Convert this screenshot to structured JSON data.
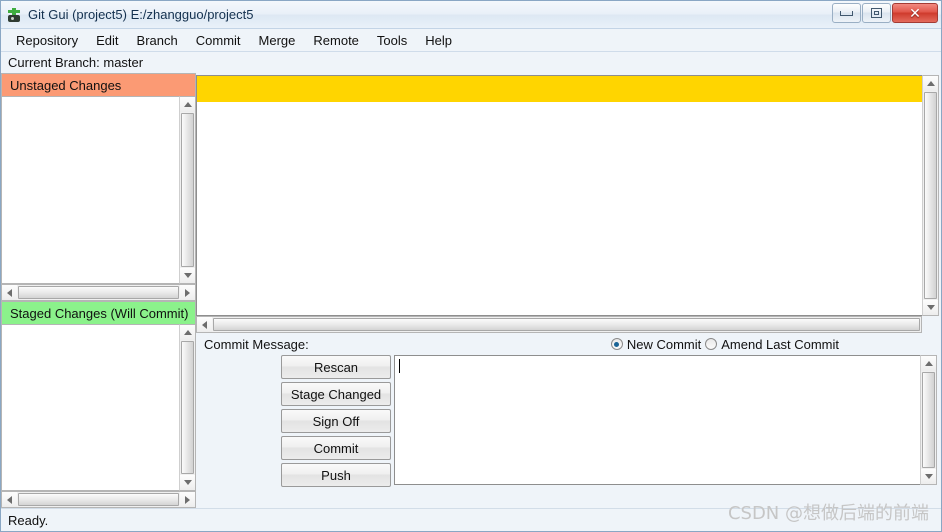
{
  "window": {
    "title": "Git Gui (project5) E:/zhangguo/project5",
    "icon": "git-logo-icon",
    "controls": {
      "minimize": "minimize-icon",
      "maximize": "restore-icon",
      "close": "✕"
    }
  },
  "menu": {
    "items": [
      {
        "label": "Repository"
      },
      {
        "label": "Edit"
      },
      {
        "label": "Branch"
      },
      {
        "label": "Commit"
      },
      {
        "label": "Merge"
      },
      {
        "label": "Remote"
      },
      {
        "label": "Tools"
      },
      {
        "label": "Help"
      }
    ]
  },
  "branch_bar": {
    "text": "Current Branch: master"
  },
  "panes": {
    "unstaged": {
      "header": "Unstaged Changes",
      "header_color": "#fb9a74",
      "files": []
    },
    "staged": {
      "header": "Staged Changes (Will Commit)",
      "header_color": "#8bf28b",
      "files": []
    },
    "diff": {
      "banner_color": "#ffd500",
      "banner_text": "",
      "content": ""
    }
  },
  "commit": {
    "label": "Commit Message:",
    "message_value": "",
    "mode_options": [
      {
        "label": "New Commit",
        "selected": true
      },
      {
        "label": "Amend Last Commit",
        "selected": false
      }
    ],
    "buttons": [
      {
        "label": "Rescan"
      },
      {
        "label": "Stage Changed"
      },
      {
        "label": "Sign Off"
      },
      {
        "label": "Commit"
      },
      {
        "label": "Push"
      }
    ]
  },
  "status_bar": {
    "text": "Ready."
  },
  "watermark": {
    "text": "CSDN @想做后端的前端"
  }
}
